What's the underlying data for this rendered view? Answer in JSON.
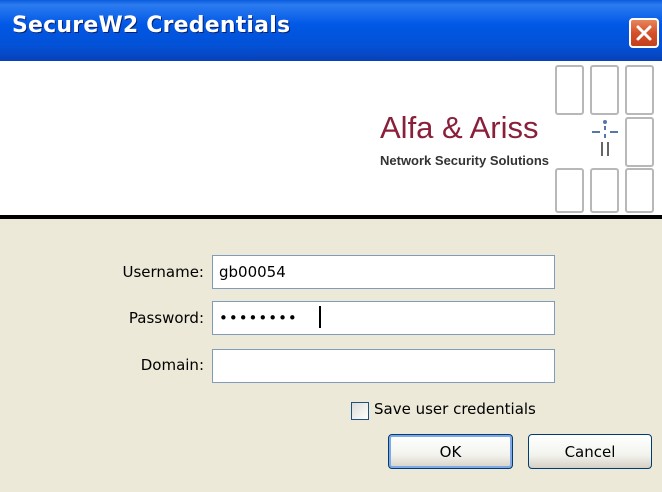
{
  "window": {
    "title": "SecureW2 Credentials"
  },
  "banner": {
    "company_name": "Alfa & Ariss",
    "tagline": "Network Security Solutions",
    "brand_color": "#8A1F3A"
  },
  "form": {
    "username": {
      "label": "Username:",
      "value": "gb00054"
    },
    "password": {
      "label": "Password:",
      "value": "••••••••"
    },
    "domain": {
      "label": "Domain:",
      "value": ""
    },
    "save_credentials": {
      "label": "Save user credentials",
      "checked": false
    }
  },
  "buttons": {
    "ok": "OK",
    "cancel": "Cancel"
  },
  "icons": {
    "close": "close-icon",
    "logo": "alfa-ariss-logo-icon"
  }
}
